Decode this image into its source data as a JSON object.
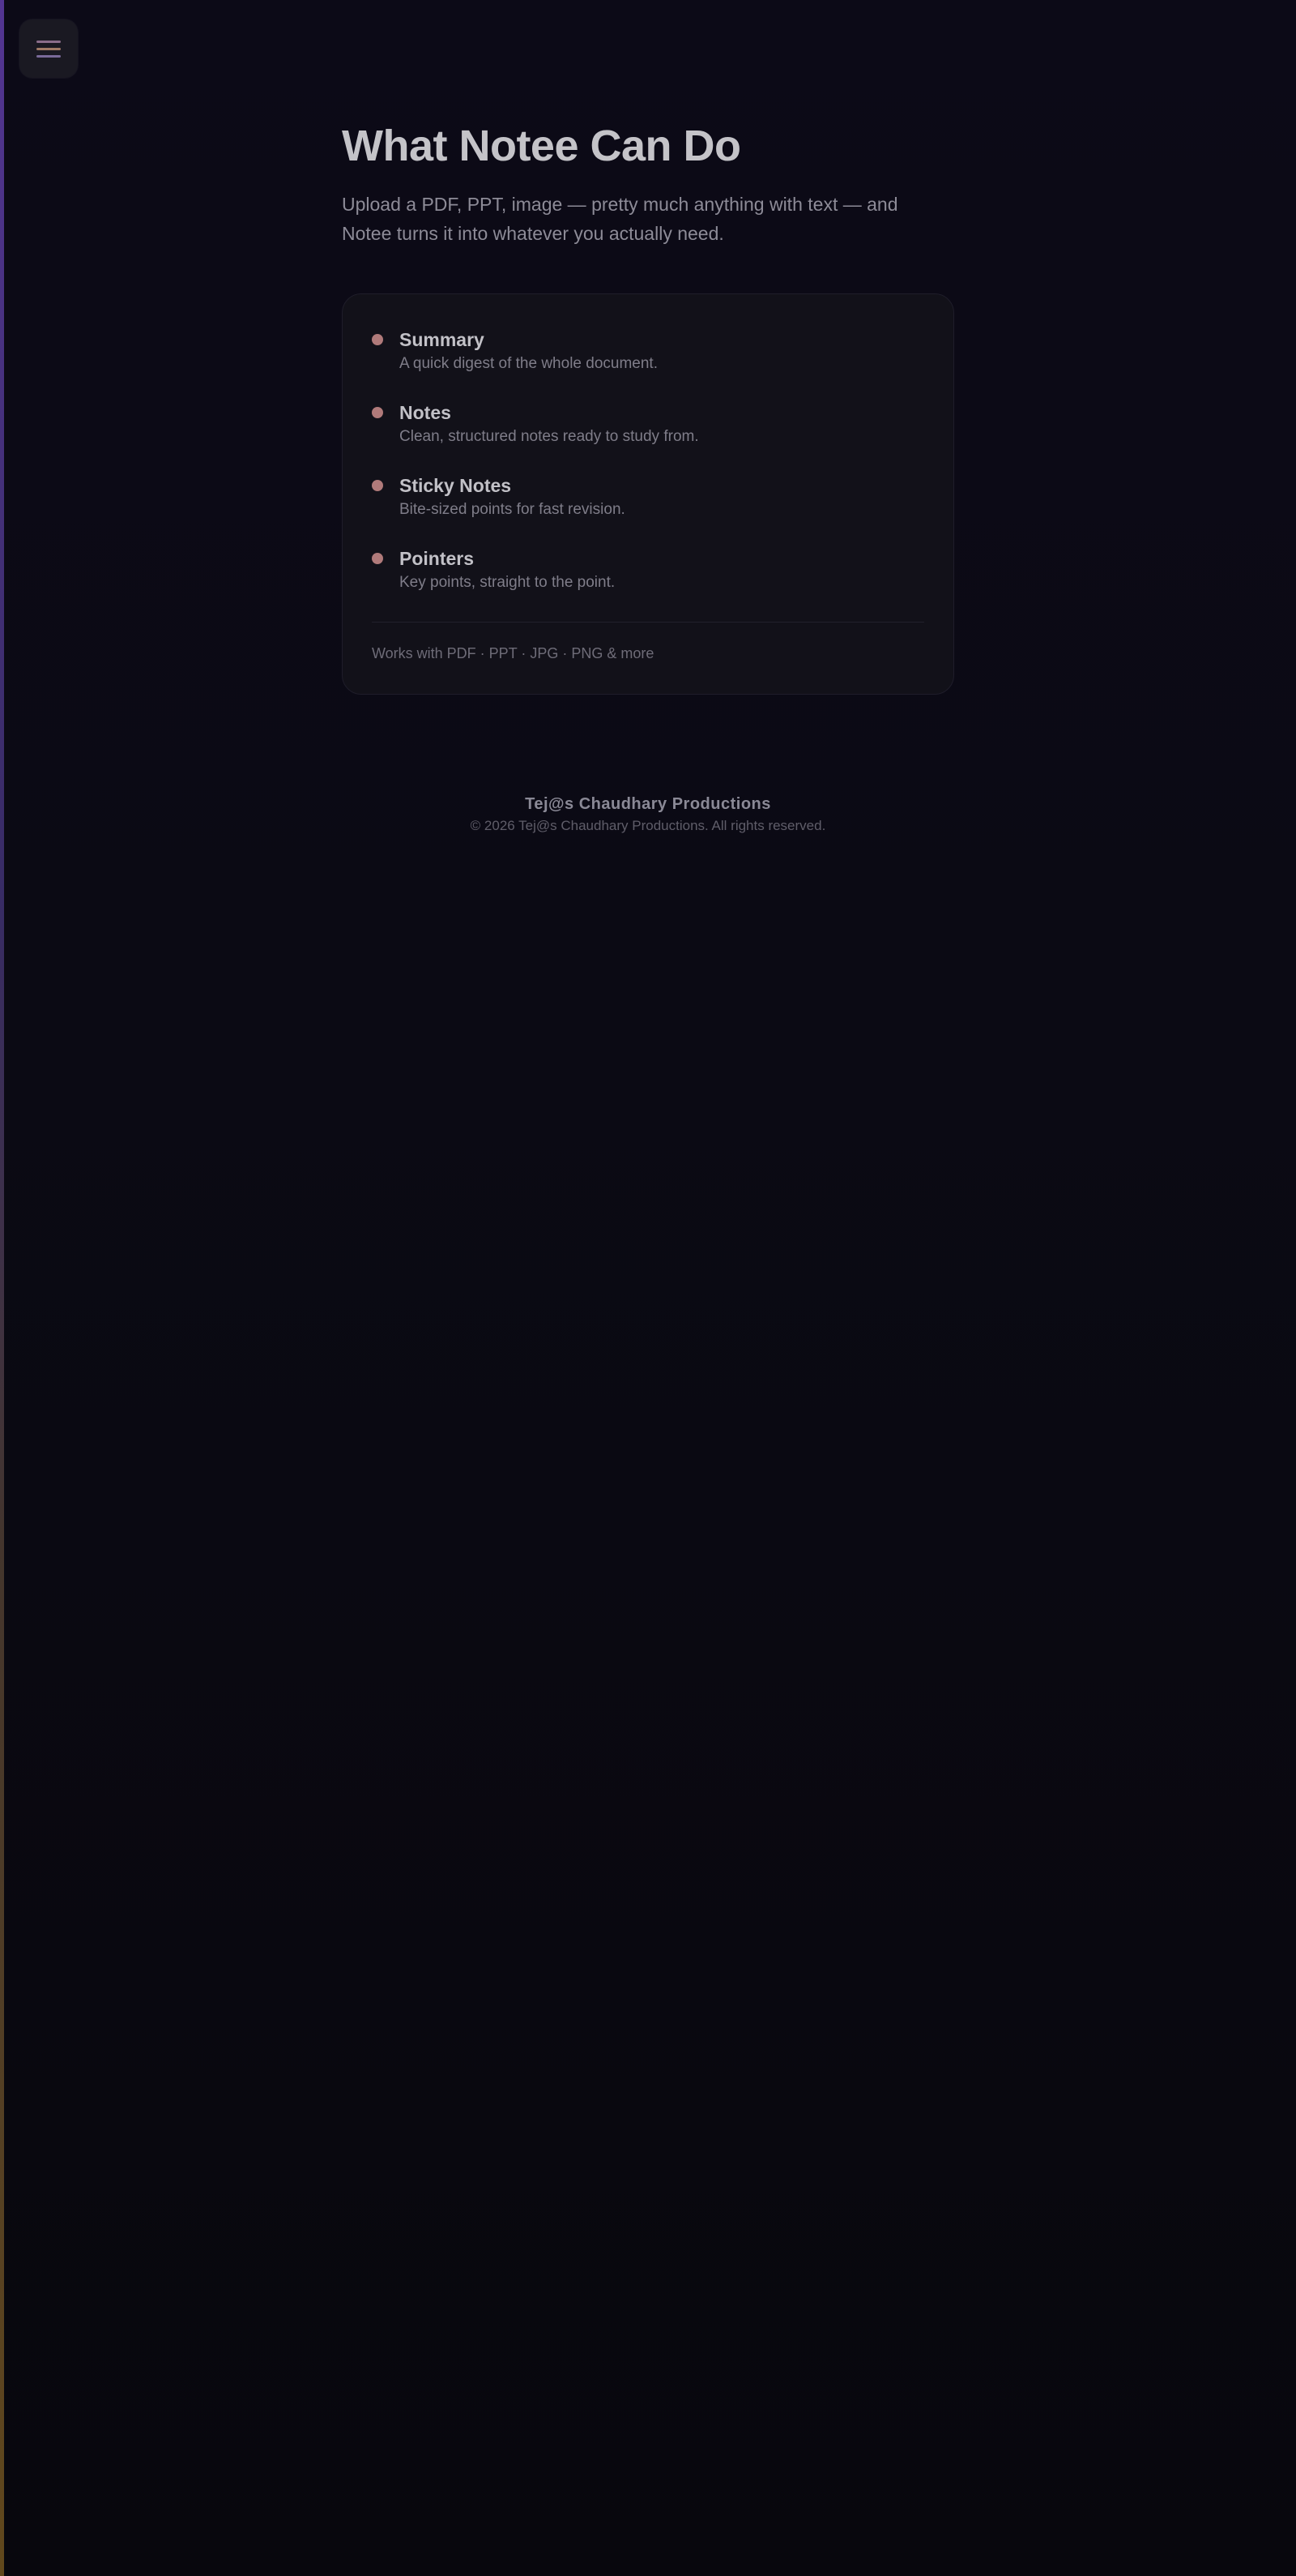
{
  "colors": {
    "background": "#0b0a14",
    "card": "#121119",
    "accent_dot": "#b07a7a",
    "edge_top": "#5b3aa0",
    "edge_bottom": "#6b4f1e"
  },
  "menu": {
    "icon": "hamburger-menu-icon"
  },
  "main": {
    "title": "What Notee Can Do",
    "intro": "Upload a PDF, PPT, image — pretty much anything with text — and Notee turns it into whatever you actually need."
  },
  "features": {
    "items": [
      {
        "title": "Summary",
        "description": "A quick digest of the whole document."
      },
      {
        "title": "Notes",
        "description": "Clean, structured notes ready to study from."
      },
      {
        "title": "Sticky Notes",
        "description": "Bite-sized points for fast revision."
      },
      {
        "title": "Pointers",
        "description": "Key points, straight to the point."
      }
    ],
    "formats": "Works with PDF · PPT · JPG · PNG & more"
  },
  "footer": {
    "brand": "Tej@s Chaudhary Productions",
    "copyright": "© 2026 Tej@s Chaudhary Productions. All rights reserved."
  }
}
